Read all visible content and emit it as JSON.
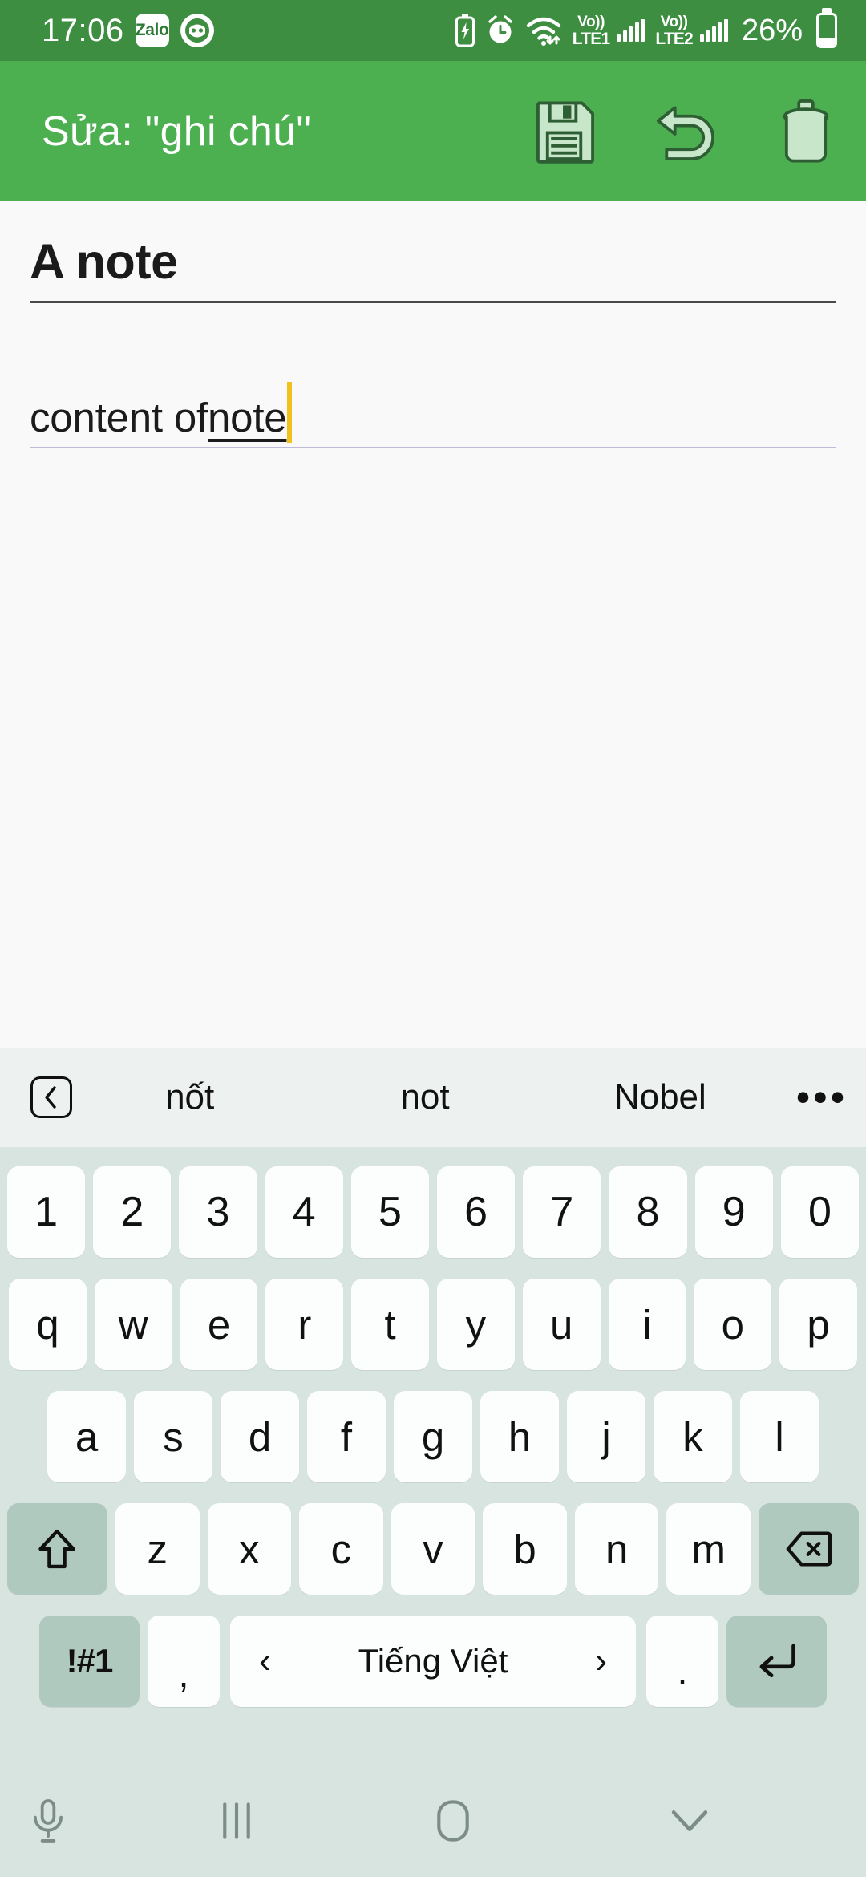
{
  "statusbar": {
    "time": "17:06",
    "zalo_label": "Zalo",
    "network1": {
      "volte": "Vo))",
      "lte": "LTE1"
    },
    "network2": {
      "volte": "Vo))",
      "lte": "LTE2"
    },
    "battery_percent": "26%",
    "icons": [
      "battery-saver-icon",
      "alarm-icon",
      "wifi-icon",
      "signal-icon",
      "battery-icon"
    ],
    "background_color": "#3E8E41"
  },
  "appbar": {
    "title": "Sửa: \"ghi chú\"",
    "background_color": "#4CAF50",
    "icon_fill": "#C8E6C9",
    "icon_stroke": "#2E5E34",
    "actions": [
      {
        "name": "save",
        "icon": "floppy-disk-icon"
      },
      {
        "name": "undo",
        "icon": "undo-arrow-icon"
      },
      {
        "name": "delete",
        "icon": "trash-icon"
      }
    ]
  },
  "editor": {
    "title_value": "A note",
    "body_text_plain": "content of ",
    "body_text_composing": "note",
    "caret_color": "#F2C11B",
    "background_color": "#F9F9F9"
  },
  "keyboard": {
    "suggestions": {
      "nav_icon": "chevron-left-boxed-icon",
      "words": [
        "nốt",
        "not",
        "Nobel"
      ],
      "more_icon": "overflow-dots-icon",
      "background_color": "#EDF1F0"
    },
    "background_color": "#D7E4DF",
    "key_color": "#FCFDFD",
    "fn_key_color": "#AFC9BF",
    "rows": {
      "numbers": [
        "1",
        "2",
        "3",
        "4",
        "5",
        "6",
        "7",
        "8",
        "9",
        "0"
      ],
      "qwerty": [
        "q",
        "w",
        "e",
        "r",
        "t",
        "y",
        "u",
        "i",
        "o",
        "p"
      ],
      "asdf": [
        "a",
        "s",
        "d",
        "f",
        "g",
        "h",
        "j",
        "k",
        "l"
      ],
      "zxcv": [
        "z",
        "x",
        "c",
        "v",
        "b",
        "n",
        "m"
      ]
    },
    "shift_icon": "shift-up-arrow-icon",
    "backspace_icon": "backspace-delete-icon",
    "symbols_label": "!#1",
    "comma_label": ",",
    "period_label": ".",
    "space_label": "Tiếng Việt",
    "space_prev": "‹",
    "space_next": "›",
    "enter_icon": "enter-return-icon"
  },
  "navbar": {
    "background_color": "#D7E4DF",
    "icon_color": "#7C8C86",
    "buttons": [
      {
        "name": "voice-input",
        "icon": "microphone-icon"
      },
      {
        "name": "recents",
        "icon": "recents-bars-icon"
      },
      {
        "name": "home",
        "icon": "home-pill-icon"
      },
      {
        "name": "hide-keyboard",
        "icon": "chevron-down-icon"
      }
    ]
  }
}
